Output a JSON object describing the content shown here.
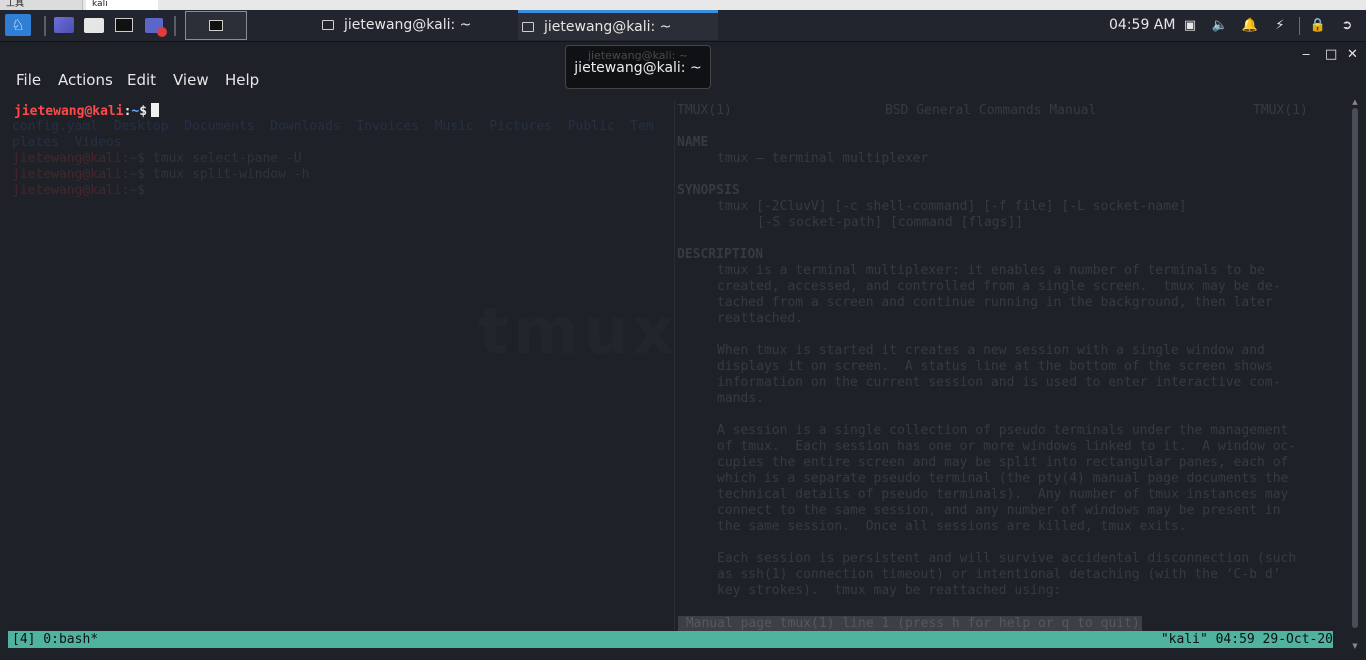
{
  "host": {
    "tab1": "工具",
    "tab2": "kali"
  },
  "taskbar": {
    "tasks": [
      {
        "label": "jietewang@kali: ~"
      },
      {
        "label": "jietewang@kali: ~"
      }
    ],
    "clock": "04:59 AM"
  },
  "tooltip": {
    "ghost": "jietewang@kali: ~",
    "title": "jietewang@kali: ~"
  },
  "window": {
    "minimize": "‒",
    "maximize": "□",
    "close": "✕"
  },
  "menu": {
    "file": "File",
    "actions": "Actions",
    "edit": "Edit",
    "view": "View",
    "help": "Help"
  },
  "terminal": {
    "prompt_user": "jietewang@kali",
    "prompt_path": "~",
    "prompt_sign": "$",
    "ls_line1": "config.yaml  Desktop  Documents  Downloads  Invoices  Music  Pictures  Public  Tem",
    "ls_line2": "plates  Videos",
    "cmd1": "tmux select-pane -U",
    "cmd2": "tmux split-window -h",
    "watermark": "tmux"
  },
  "man": {
    "header_left": "TMUX(1)",
    "header_center": "BSD General Commands Manual",
    "header_right": "TMUX(1)",
    "name_title": "NAME",
    "name_line": "tmux — terminal multiplexer",
    "synopsis_title": "SYNOPSIS",
    "syn1": "tmux [-2CluvV] [-c shell-command] [-f file] [-L socket-name]",
    "syn2": "[-S socket-path] [command [flags]]",
    "desc_title": "DESCRIPTION",
    "p1_1": "tmux is a terminal multiplexer: it enables a number of terminals to be",
    "p1_2": "created, accessed, and controlled from a single screen.  tmux may be de‐",
    "p1_3": "tached from a screen and continue running in the background, then later",
    "p1_4": "reattached.",
    "p2_1": "When tmux is started it creates a new session with a single window and",
    "p2_2": "displays it on screen.  A status line at the bottom of the screen shows",
    "p2_3": "information on the current session and is used to enter interactive com‐",
    "p2_4": "mands.",
    "p3_1": "A session is a single collection of pseudo terminals under the management",
    "p3_2": "of tmux.  Each session has one or more windows linked to it.  A window oc‐",
    "p3_3": "cupies the entire screen and may be split into rectangular panes, each of",
    "p3_4": "which is a separate pseudo terminal (the pty(4) manual page documents the",
    "p3_5": "technical details of pseudo terminals).  Any number of tmux instances may",
    "p3_6": "connect to the same session, and any number of windows may be present in",
    "p3_7": "the same session.  Once all sessions are killed, tmux exits.",
    "p4_1": "Each session is persistent and will survive accidental disconnection (such",
    "p4_2": "as ssh(1) connection timeout) or intentional detaching (with the ‘C-b d’",
    "p4_3": "key strokes).  tmux may be reattached using:",
    "status": " Manual page tmux(1) line 1 (press h for help or q to quit)"
  },
  "tmux_status": {
    "left": "[4] 0:bash*",
    "right": "\"kali\" 04:59 29-Oct-20"
  },
  "colors": {
    "accent": "#3b8fe0",
    "status_bar": "#4fb3a0",
    "prompt_user": "#ff4a4a",
    "prompt_path": "#5fa8ff"
  }
}
